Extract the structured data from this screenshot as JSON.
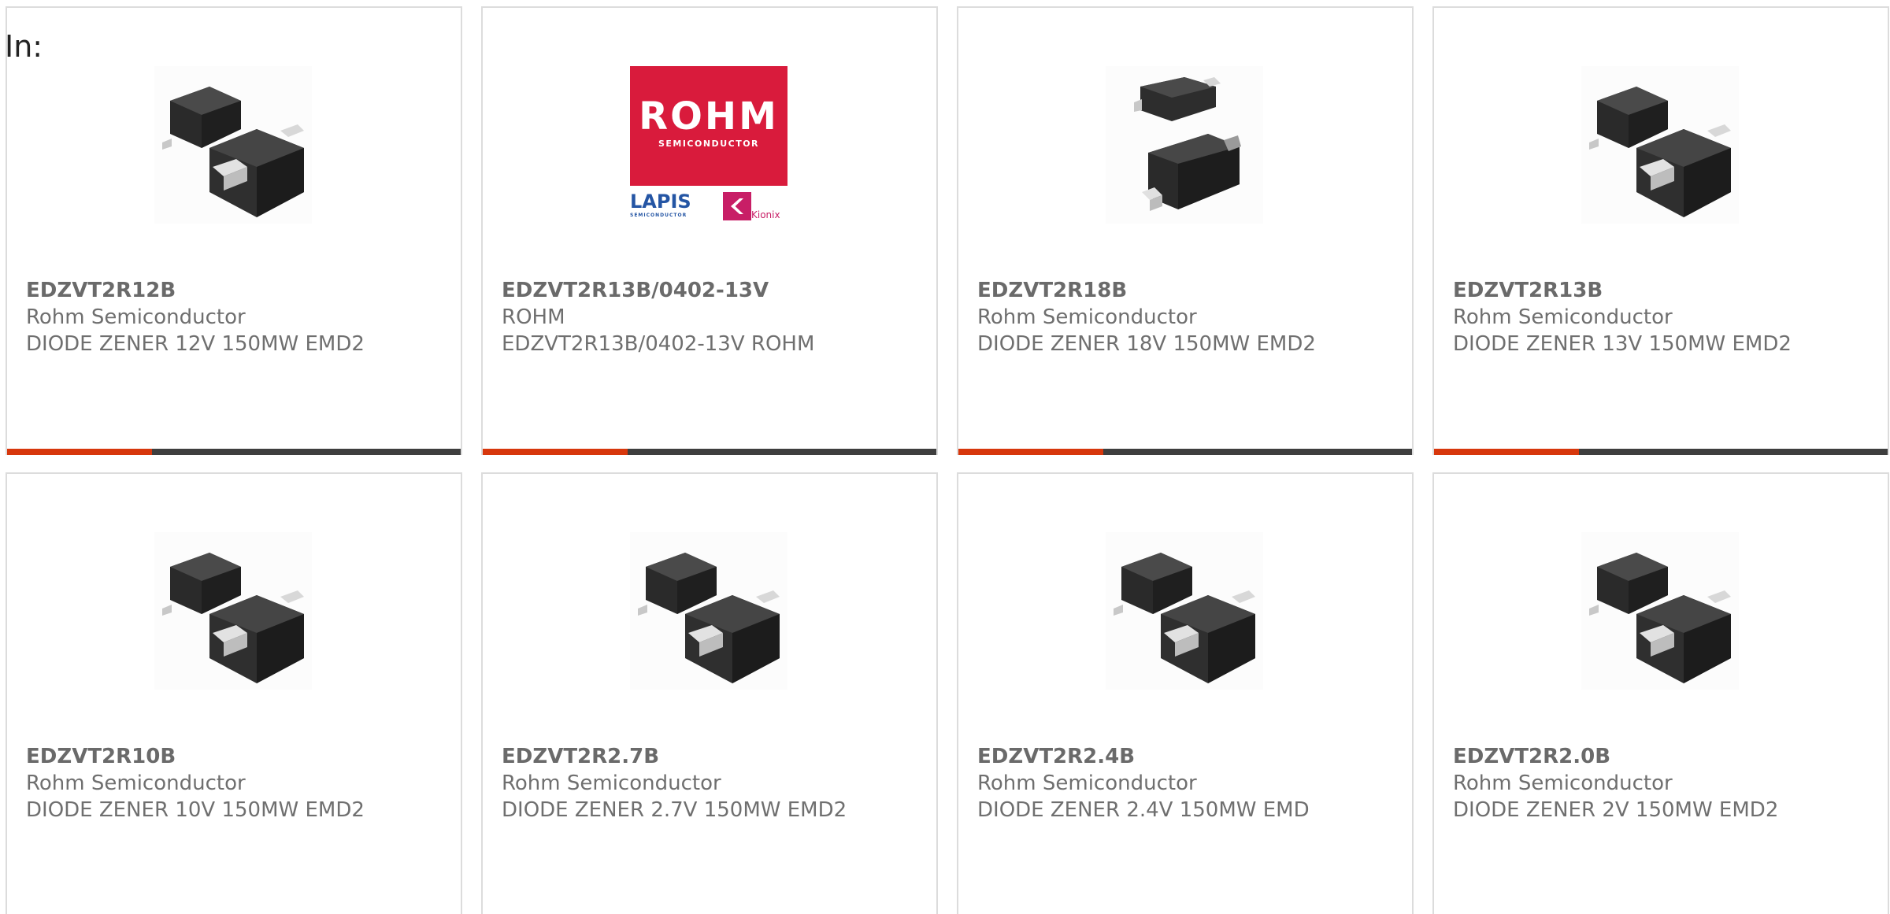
{
  "header": {
    "in_label": "In:"
  },
  "colors": {
    "accent": "#d7370c",
    "bar": "#3e3e3e",
    "text": "#6f6f6f",
    "rohm_red": "#d91b3c",
    "lapis_blue": "#2455a4",
    "kionix_magenta": "#c81e66"
  },
  "products": [
    {
      "part": "EDZVT2R12B",
      "manufacturer": "Rohm Semiconductor",
      "description": "DIODE ZENER 12V 150MW EMD2",
      "image": "diode-pair-icon"
    },
    {
      "part": "EDZVT2R13B/0402-13V",
      "manufacturer": "ROHM",
      "description": "EDZVT2R13B/0402-13V ROHM",
      "image": "rohm-logo"
    },
    {
      "part": "EDZVT2R18B",
      "manufacturer": "Rohm Semiconductor",
      "description": "DIODE ZENER 18V 150MW EMD2",
      "image": "diode-stacked-icon"
    },
    {
      "part": "EDZVT2R13B",
      "manufacturer": "Rohm Semiconductor",
      "description": "DIODE ZENER 13V 150MW EMD2",
      "image": "diode-pair-icon"
    },
    {
      "part": "EDZVT2R10B",
      "manufacturer": "Rohm Semiconductor",
      "description": "DIODE ZENER 10V 150MW EMD2",
      "image": "diode-pair-icon"
    },
    {
      "part": "EDZVT2R2.7B",
      "manufacturer": "Rohm Semiconductor",
      "description": "DIODE ZENER 2.7V 150MW EMD2",
      "image": "diode-pair-icon"
    },
    {
      "part": "EDZVT2R2.4B",
      "manufacturer": "Rohm Semiconductor",
      "description": "DIODE ZENER 2.4V 150MW EMD",
      "image": "diode-pair-icon"
    },
    {
      "part": "EDZVT2R2.0B",
      "manufacturer": "Rohm Semiconductor",
      "description": "DIODE ZENER 2V 150MW EMD2",
      "image": "diode-pair-icon"
    }
  ],
  "rohm_logo": {
    "main": "ROHM",
    "sub": "SEMICONDUCTOR",
    "lapis": "LAPIS",
    "lapis_sub": "SEMICONDUCTOR",
    "kionix": "Kionix"
  }
}
